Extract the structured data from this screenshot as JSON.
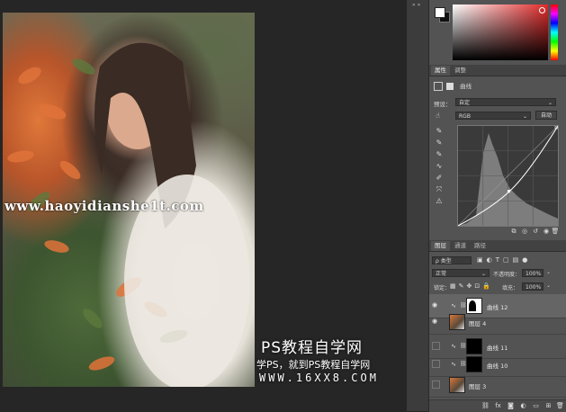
{
  "canvas": {
    "watermark_url": "www.haoyidianshe1t.com",
    "watermark_title": "PS教程自学网",
    "watermark_subtitle": "学PS，就到PS教程自学网",
    "watermark_site": "WWW.16XX8.COM"
  },
  "colors": {
    "foreground": "#ffffff",
    "background": "#111111",
    "picker_hue": "#e22a2a"
  },
  "properties_panel": {
    "tabs": [
      "属性",
      "调整"
    ],
    "active_tab": "属性",
    "title": "曲线",
    "preset_label": "预设：",
    "preset_value": "自定",
    "channel_value": "RGB",
    "auto_button": "自动",
    "curve_tools": [
      "pointer-hand-icon",
      "eyedropper-black-icon",
      "eyedropper-gray-icon",
      "eyedropper-white-icon",
      "curve-point-icon",
      "pencil-icon",
      "smooth-icon",
      "warning-icon"
    ],
    "bottom_icons": [
      "clip-icon",
      "view-previous-icon",
      "reset-icon",
      "visibility-icon",
      "delete-icon"
    ]
  },
  "layers_panel": {
    "tabs": [
      "图层",
      "通道",
      "路径"
    ],
    "active_tab": "图层",
    "filter_kind": "ρ 类型",
    "blend_mode": "正常",
    "opacity_label": "不透明度：",
    "opacity_value": "100%",
    "lock_label": "锁定：",
    "fill_label": "填充：",
    "fill_value": "100%",
    "layers": [
      {
        "name": "曲线 12",
        "type": "adjustment",
        "visible": true,
        "selected": true
      },
      {
        "name": "图层 4",
        "type": "pixel",
        "visible": true,
        "selected": false
      },
      {
        "name": "曲线 11",
        "type": "adjustment",
        "visible": false,
        "selected": false
      },
      {
        "name": "曲线 10",
        "type": "adjustment",
        "visible": false,
        "selected": false
      },
      {
        "name": "图层 3",
        "type": "pixel",
        "visible": false,
        "selected": false
      }
    ],
    "footer_icons": [
      "link-icon",
      "fx-icon",
      "mask-icon",
      "adjustment-icon",
      "group-icon",
      "new-layer-icon",
      "trash-icon"
    ]
  }
}
